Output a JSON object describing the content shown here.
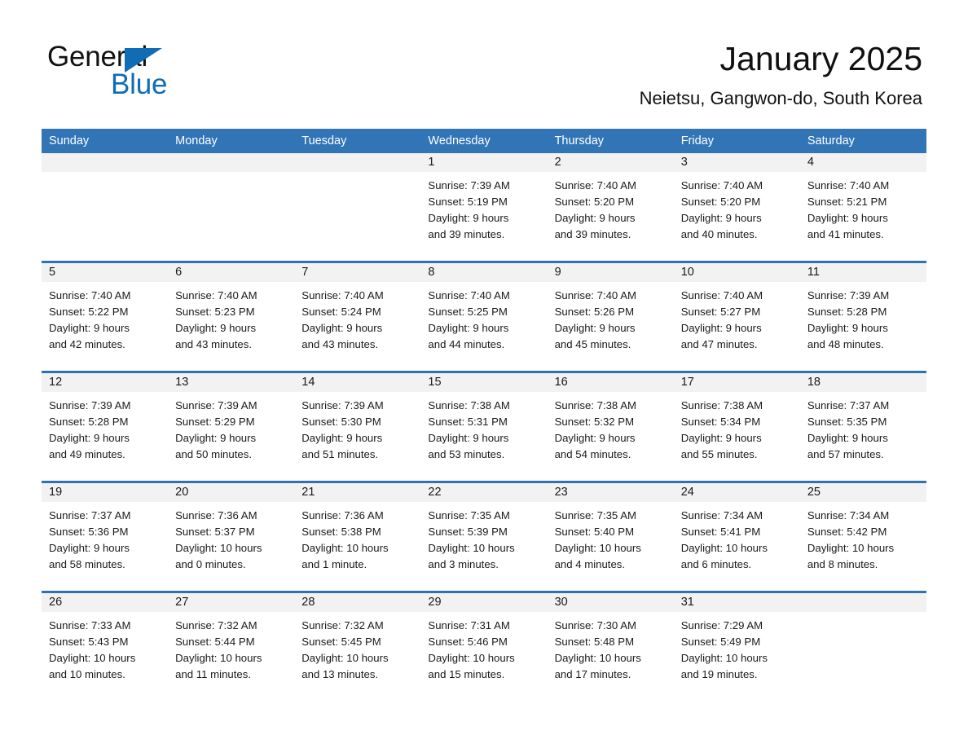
{
  "brand": {
    "word1": "General",
    "word2": "Blue",
    "triangle_color": "#0f6cb5"
  },
  "header": {
    "title": "January 2025",
    "subtitle": "Neietsu, Gangwon-do, South Korea"
  },
  "theme": {
    "header_bg": "#3275b6",
    "row_divider": "#2f72b4",
    "numband_bg": "#f2f2f2",
    "text": "#1a1a1a"
  },
  "weekdays": [
    "Sunday",
    "Monday",
    "Tuesday",
    "Wednesday",
    "Thursday",
    "Friday",
    "Saturday"
  ],
  "weeks": [
    [
      {
        "day": "",
        "lines": []
      },
      {
        "day": "",
        "lines": []
      },
      {
        "day": "",
        "lines": []
      },
      {
        "day": "1",
        "lines": [
          "Sunrise: 7:39 AM",
          "Sunset: 5:19 PM",
          "Daylight: 9 hours",
          "and 39 minutes."
        ]
      },
      {
        "day": "2",
        "lines": [
          "Sunrise: 7:40 AM",
          "Sunset: 5:20 PM",
          "Daylight: 9 hours",
          "and 39 minutes."
        ]
      },
      {
        "day": "3",
        "lines": [
          "Sunrise: 7:40 AM",
          "Sunset: 5:20 PM",
          "Daylight: 9 hours",
          "and 40 minutes."
        ]
      },
      {
        "day": "4",
        "lines": [
          "Sunrise: 7:40 AM",
          "Sunset: 5:21 PM",
          "Daylight: 9 hours",
          "and 41 minutes."
        ]
      }
    ],
    [
      {
        "day": "5",
        "lines": [
          "Sunrise: 7:40 AM",
          "Sunset: 5:22 PM",
          "Daylight: 9 hours",
          "and 42 minutes."
        ]
      },
      {
        "day": "6",
        "lines": [
          "Sunrise: 7:40 AM",
          "Sunset: 5:23 PM",
          "Daylight: 9 hours",
          "and 43 minutes."
        ]
      },
      {
        "day": "7",
        "lines": [
          "Sunrise: 7:40 AM",
          "Sunset: 5:24 PM",
          "Daylight: 9 hours",
          "and 43 minutes."
        ]
      },
      {
        "day": "8",
        "lines": [
          "Sunrise: 7:40 AM",
          "Sunset: 5:25 PM",
          "Daylight: 9 hours",
          "and 44 minutes."
        ]
      },
      {
        "day": "9",
        "lines": [
          "Sunrise: 7:40 AM",
          "Sunset: 5:26 PM",
          "Daylight: 9 hours",
          "and 45 minutes."
        ]
      },
      {
        "day": "10",
        "lines": [
          "Sunrise: 7:40 AM",
          "Sunset: 5:27 PM",
          "Daylight: 9 hours",
          "and 47 minutes."
        ]
      },
      {
        "day": "11",
        "lines": [
          "Sunrise: 7:39 AM",
          "Sunset: 5:28 PM",
          "Daylight: 9 hours",
          "and 48 minutes."
        ]
      }
    ],
    [
      {
        "day": "12",
        "lines": [
          "Sunrise: 7:39 AM",
          "Sunset: 5:28 PM",
          "Daylight: 9 hours",
          "and 49 minutes."
        ]
      },
      {
        "day": "13",
        "lines": [
          "Sunrise: 7:39 AM",
          "Sunset: 5:29 PM",
          "Daylight: 9 hours",
          "and 50 minutes."
        ]
      },
      {
        "day": "14",
        "lines": [
          "Sunrise: 7:39 AM",
          "Sunset: 5:30 PM",
          "Daylight: 9 hours",
          "and 51 minutes."
        ]
      },
      {
        "day": "15",
        "lines": [
          "Sunrise: 7:38 AM",
          "Sunset: 5:31 PM",
          "Daylight: 9 hours",
          "and 53 minutes."
        ]
      },
      {
        "day": "16",
        "lines": [
          "Sunrise: 7:38 AM",
          "Sunset: 5:32 PM",
          "Daylight: 9 hours",
          "and 54 minutes."
        ]
      },
      {
        "day": "17",
        "lines": [
          "Sunrise: 7:38 AM",
          "Sunset: 5:34 PM",
          "Daylight: 9 hours",
          "and 55 minutes."
        ]
      },
      {
        "day": "18",
        "lines": [
          "Sunrise: 7:37 AM",
          "Sunset: 5:35 PM",
          "Daylight: 9 hours",
          "and 57 minutes."
        ]
      }
    ],
    [
      {
        "day": "19",
        "lines": [
          "Sunrise: 7:37 AM",
          "Sunset: 5:36 PM",
          "Daylight: 9 hours",
          "and 58 minutes."
        ]
      },
      {
        "day": "20",
        "lines": [
          "Sunrise: 7:36 AM",
          "Sunset: 5:37 PM",
          "Daylight: 10 hours",
          "and 0 minutes."
        ]
      },
      {
        "day": "21",
        "lines": [
          "Sunrise: 7:36 AM",
          "Sunset: 5:38 PM",
          "Daylight: 10 hours",
          "and 1 minute."
        ]
      },
      {
        "day": "22",
        "lines": [
          "Sunrise: 7:35 AM",
          "Sunset: 5:39 PM",
          "Daylight: 10 hours",
          "and 3 minutes."
        ]
      },
      {
        "day": "23",
        "lines": [
          "Sunrise: 7:35 AM",
          "Sunset: 5:40 PM",
          "Daylight: 10 hours",
          "and 4 minutes."
        ]
      },
      {
        "day": "24",
        "lines": [
          "Sunrise: 7:34 AM",
          "Sunset: 5:41 PM",
          "Daylight: 10 hours",
          "and 6 minutes."
        ]
      },
      {
        "day": "25",
        "lines": [
          "Sunrise: 7:34 AM",
          "Sunset: 5:42 PM",
          "Daylight: 10 hours",
          "and 8 minutes."
        ]
      }
    ],
    [
      {
        "day": "26",
        "lines": [
          "Sunrise: 7:33 AM",
          "Sunset: 5:43 PM",
          "Daylight: 10 hours",
          "and 10 minutes."
        ]
      },
      {
        "day": "27",
        "lines": [
          "Sunrise: 7:32 AM",
          "Sunset: 5:44 PM",
          "Daylight: 10 hours",
          "and 11 minutes."
        ]
      },
      {
        "day": "28",
        "lines": [
          "Sunrise: 7:32 AM",
          "Sunset: 5:45 PM",
          "Daylight: 10 hours",
          "and 13 minutes."
        ]
      },
      {
        "day": "29",
        "lines": [
          "Sunrise: 7:31 AM",
          "Sunset: 5:46 PM",
          "Daylight: 10 hours",
          "and 15 minutes."
        ]
      },
      {
        "day": "30",
        "lines": [
          "Sunrise: 7:30 AM",
          "Sunset: 5:48 PM",
          "Daylight: 10 hours",
          "and 17 minutes."
        ]
      },
      {
        "day": "31",
        "lines": [
          "Sunrise: 7:29 AM",
          "Sunset: 5:49 PM",
          "Daylight: 10 hours",
          "and 19 minutes."
        ]
      },
      {
        "day": "",
        "lines": []
      }
    ]
  ]
}
